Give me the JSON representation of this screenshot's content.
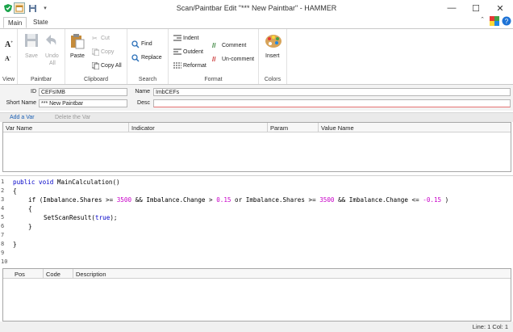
{
  "window": {
    "title": "Scan/Paintbar Edit \"*** New Paintbar\" - HAMMER",
    "minimize_glyph": "—",
    "maximize_glyph": "☐",
    "close_glyph": "✕"
  },
  "tabs": [
    {
      "label": "Main",
      "active": true
    },
    {
      "label": "State",
      "active": false
    }
  ],
  "ribbon": {
    "view": {
      "label": "View"
    },
    "paintbar": {
      "label": "Paintbar",
      "save": "Save",
      "undo": "Undo",
      "undo2": "All"
    },
    "clipboard": {
      "label": "Clipboard",
      "paste": "Paste",
      "cut": "Cut",
      "copy": "Copy",
      "copy_all": "Copy All"
    },
    "search": {
      "label": "Search",
      "find": "Find",
      "replace": "Replace"
    },
    "format": {
      "label": "Format",
      "indent": "Indent",
      "outdent": "Outdent",
      "reformat": "Reformat",
      "comment": "Comment",
      "uncomment": "Un-comment"
    },
    "colors": {
      "label": "Colors",
      "insert": "Insert"
    }
  },
  "props": {
    "id_label": "ID",
    "id_value": "CEFsIMB",
    "name_label": "Name",
    "name_value": "ImbCEFs",
    "short_name_label": "Short Name",
    "short_name_value": "*** New Paintbar",
    "desc_label": "Desc",
    "desc_value": ""
  },
  "vars": {
    "add_label": "Add a Var",
    "delete_label": "Delete the Var",
    "columns": [
      "Var Name",
      "Indicator",
      "Param",
      "Value Name"
    ]
  },
  "code": {
    "line_numbers": [
      "1",
      "2",
      "3",
      "4",
      "5",
      "6",
      "7",
      "8",
      "9",
      "10"
    ],
    "sig_kw1": "public",
    "sig_kw2": "void",
    "sig_name": "MainCalculation()",
    "open_brace": "{",
    "if_a": "if (Imbalance.Shares >= ",
    "n1": "3500",
    "if_b": " && Imbalance.Change > ",
    "n2": "0.15",
    "if_c": " or Imbalance.Shares >= ",
    "n3": "3500",
    "if_d": " && Imbalance.Change <= ",
    "n4": "-0.15",
    "if_e": " )",
    "inner_open": "{",
    "call_a": "SetScanResult(",
    "call_kw": "true",
    "call_b": ");",
    "inner_close": "}",
    "close_brace": "}"
  },
  "errors": {
    "columns": [
      "Pos",
      "Code",
      "Description"
    ]
  },
  "status": {
    "text": "Line: 1  Col: 1"
  }
}
